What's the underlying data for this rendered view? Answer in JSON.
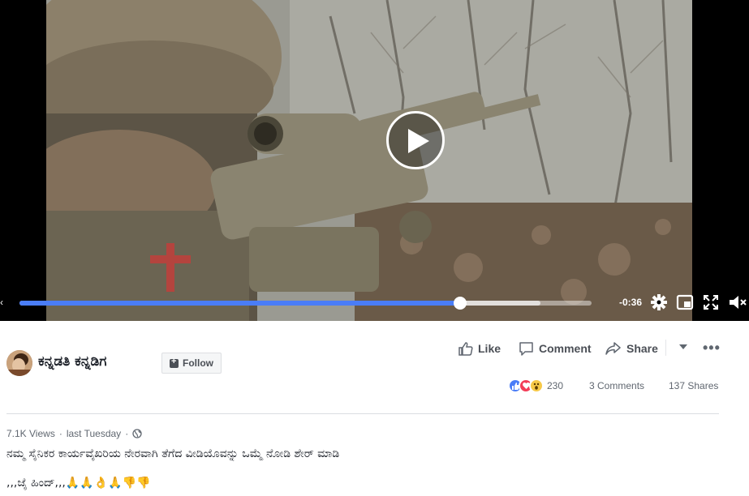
{
  "video": {
    "time_remaining": "-0:36",
    "progress_played": 0.77,
    "progress_buffered": 0.91,
    "icons": [
      "play-icon",
      "settings-gear-icon",
      "picture-in-picture-icon",
      "fullscreen-icon",
      "volume-muted-icon"
    ],
    "accent_color": "#4a7df7"
  },
  "post": {
    "page_name": "ಕನ್ನಡತಿ ಕನ್ನಡಿಗ",
    "follow_label": "Follow",
    "actions": {
      "like": "Like",
      "comment": "Comment",
      "share": "Share"
    },
    "reactions_count": "230",
    "reaction_types": [
      "like",
      "love",
      "wow"
    ],
    "comments": "3 Comments",
    "shares": "137 Shares",
    "views": "7.1K Views",
    "time": "last Tuesday",
    "dot": "·",
    "caption_line1": "ನಮ್ಮ ಸೈನಿಕರ ಕಾರ್ಯವೈಖರಿಯ ನೇರವಾಗಿ ತೆಗೆದ ವೀಡಿಯೊವನ್ನು ಒಮ್ಮೆ ನೋಡಿ ಶೇರ್ ಮಾಡಿ",
    "caption_line2": ",,,ಜೈ ಹಿಂದ್,,,🙏🙏👌🙏👎👎"
  }
}
